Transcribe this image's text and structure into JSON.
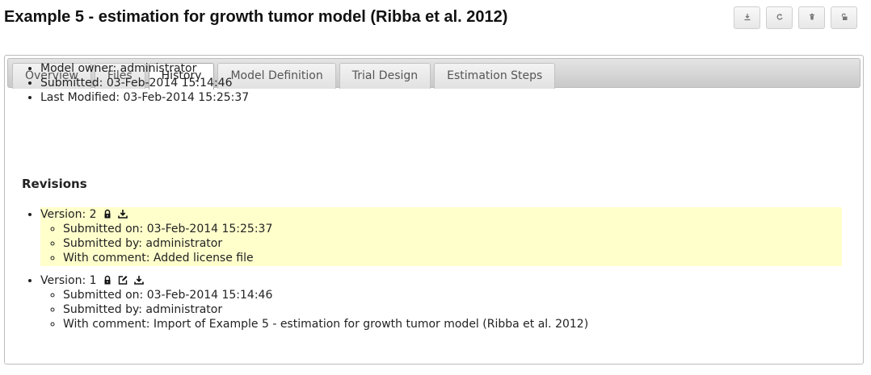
{
  "page": {
    "title": "Example 5 - estimation for growth tumor model (Ribba et al. 2012)"
  },
  "toolbar": {
    "buttons": [
      {
        "icon": "download-icon"
      },
      {
        "icon": "refresh-icon"
      },
      {
        "icon": "trash-icon"
      },
      {
        "icon": "unlock-icon"
      }
    ]
  },
  "tabs": [
    {
      "label": "Overview",
      "active": false
    },
    {
      "label": "Files",
      "active": false
    },
    {
      "label": "History",
      "active": true
    },
    {
      "label": "Model Definition",
      "active": false
    },
    {
      "label": "Trial Design",
      "active": false
    },
    {
      "label": "Estimation Steps",
      "active": false
    }
  ],
  "history": {
    "owner": "Model owner: administrator",
    "submitted": "Submitted: 03-Feb-2014 15:14:46",
    "last_modified": "Last Modified: 03-Feb-2014 15:25:37"
  },
  "revisions_heading": "Revisions",
  "revisions": [
    {
      "version": "Version: 2",
      "icons": [
        "lock-icon",
        "download-icon"
      ],
      "highlight_color": "#ffffcc",
      "submitted_on": "Submitted on: 03-Feb-2014 15:25:37",
      "submitted_by": "Submitted by: administrator",
      "comment": "With comment: Added license file"
    },
    {
      "version": "Version: 1",
      "icons": [
        "lock-icon",
        "edit-icon",
        "download-icon"
      ],
      "submitted_on": "Submitted on: 03-Feb-2014 15:14:46",
      "submitted_by": "Submitted by: administrator",
      "comment": "With comment: Import of Example 5 - estimation for growth tumor model (Ribba et al. 2012)"
    }
  ]
}
